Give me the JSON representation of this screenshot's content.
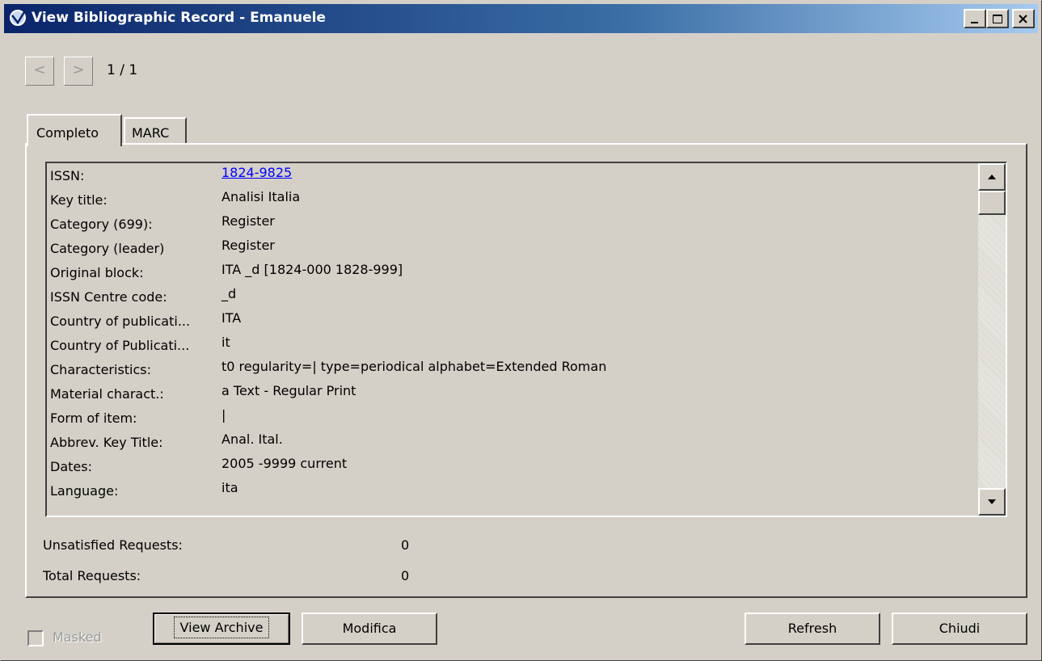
{
  "window": {
    "title": "View Bibliographic Record - Emanuele",
    "controls": [
      "minimize",
      "maximize",
      "close"
    ]
  },
  "navigation": {
    "prev_label": "<",
    "next_label": ">",
    "page_indicator": "1 / 1"
  },
  "tabs": [
    {
      "label": "Completo",
      "active": true
    },
    {
      "label": "MARC",
      "active": false
    }
  ],
  "record": {
    "rows": [
      {
        "label": "ISSN:",
        "value": "1824-9825 "
      },
      {
        "label": "Key title:",
        "value": "Analisi Italia"
      },
      {
        "label": "Category (699):",
        "value": "Register"
      },
      {
        "label": "Category (leader)",
        "value": "Register"
      },
      {
        "label": "Original block:",
        "value": "ITA _d [1824-000 1828-999]"
      },
      {
        "label": "ISSN Centre code:",
        "value": "_d"
      },
      {
        "label": "Country of publicati...",
        "value": "ITA"
      },
      {
        "label": "Country of Publicati...",
        "value": "it"
      },
      {
        "label": "Characteristics:",
        "value": "t0 regularity=| type=periodical alphabet=Extended Roman"
      },
      {
        "label": "Material charact.:",
        "value": "a Text - Regular Print"
      },
      {
        "label": "Form of item:",
        "value": " |"
      },
      {
        "label": "Abbrev. Key Title:",
        "value": "Anal. Ital."
      },
      {
        "label": "Dates:",
        "value": "2005 -9999 current"
      },
      {
        "label": "Language:",
        "value": "ita"
      }
    ]
  },
  "stats": {
    "unsatisfied_label": "Unsatisfied Requests:",
    "unsatisfied_value": "0",
    "total_label": "Total Requests:",
    "total_value": "0"
  },
  "footer": {
    "masked_label": "Masked",
    "masked_checked": false,
    "view_archive_label": "View Archive",
    "modifica_label": "Modifica",
    "refresh_label": "Refresh",
    "chiudi_label": "Chiudi"
  },
  "colors": {
    "face": "#d4d0c8",
    "title_gradient_start": "#0a246a",
    "title_gradient_end": "#a6caf0",
    "link": "#0000ff"
  }
}
